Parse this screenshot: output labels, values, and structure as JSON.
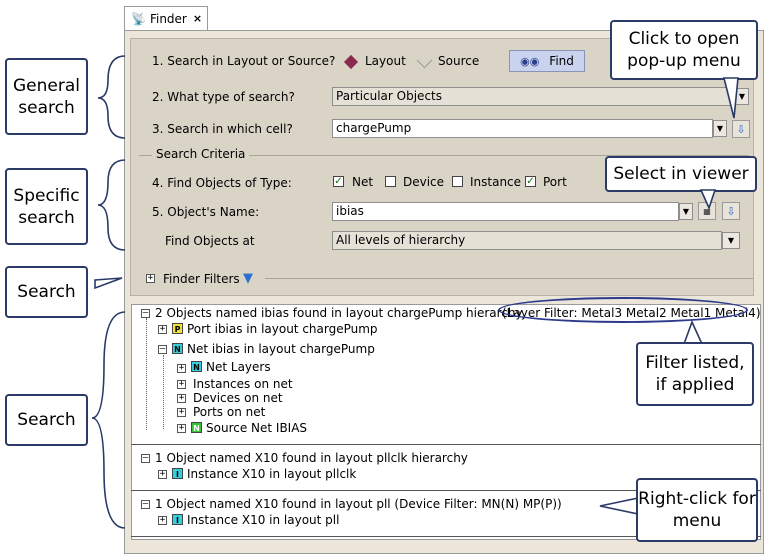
{
  "tab": {
    "title": "Finder",
    "close": "×",
    "icon": "binoculars-icon"
  },
  "form": {
    "q1_label": "1. Search in Layout or Source?",
    "q1_option_layout": "Layout",
    "q1_option_source": "Source",
    "q1_selected": "Layout",
    "find_button": "Find",
    "q2_label": "2. What type of search?",
    "q2_value": "Particular Objects",
    "q3_label": "3. Search in which cell?",
    "q3_value": "chargePump",
    "criteria_title": "Search Criteria",
    "q4_label": "4. Find Objects of Type:",
    "types": [
      {
        "label": "Net",
        "checked": true
      },
      {
        "label": "Device",
        "checked": false
      },
      {
        "label": "Instance",
        "checked": false
      },
      {
        "label": "Port",
        "checked": true
      }
    ],
    "q5_label": "5. Object's Name:",
    "q5_value": "ibias",
    "find_at_label": "Find Objects at",
    "find_at_value": "All levels of hierarchy",
    "filters_label": "Finder Filters"
  },
  "results": {
    "group1": {
      "header": "2 Objects named ibias found in layout chargePump hierarchy",
      "filter": "(Layer Filter: Metal3 Metal2 Metal1 Metal4)",
      "items": {
        "port": "Port ibias in layout chargePump",
        "net": "Net ibias in layout chargePump",
        "net_layers": "Net Layers",
        "instances": "Instances on net",
        "devices": "Devices on net",
        "ports": "Ports on net",
        "source_net": "Source Net IBIAS"
      },
      "badges": {
        "port": "P",
        "net": "N",
        "net_layers": "N",
        "source_net": "N"
      }
    },
    "group2": {
      "header": "1 Object named X10 found in layout pllclk hierarchy",
      "item": "Instance X10 in layout pllclk",
      "badge": "I"
    },
    "group3": {
      "header": "1 Object named X10 found in layout pll (Device Filter: MN(N) MP(P))",
      "item": "Instance X10 in layout pll",
      "badge": "I"
    }
  },
  "callouts": {
    "general": "General search",
    "specific": "Specific search",
    "search1": "Search",
    "search2": "Search",
    "popup": "Click to open pop-up menu",
    "viewer": "Select in viewer",
    "filter": "Filter listed, if applied",
    "rightclick": "Right-click for menu"
  },
  "colors": {
    "panel": "#ece6da",
    "form": "#dad4c7",
    "callout_border": "#2b3a66",
    "find_button": "#c9d3ee"
  }
}
